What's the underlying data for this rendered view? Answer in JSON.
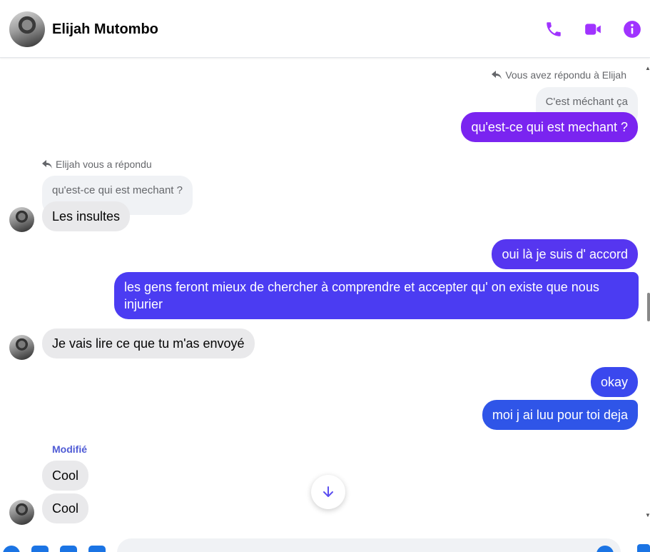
{
  "header": {
    "contact_name": "Elijah Mutombo",
    "icons": [
      "phone-icon",
      "video-camera-icon",
      "info-icon"
    ],
    "accent_color": "#a033ff"
  },
  "messages": [
    {
      "type": "reply_note",
      "text": "Vous avez répondu à Elijah"
    },
    {
      "type": "quote",
      "text": "C'est méchant ça"
    },
    {
      "type": "outgoing",
      "text": "qu'est-ce qui est mechant ?",
      "color": "#7a24f0"
    },
    {
      "type": "reply_note",
      "text": "Elijah vous a répondu"
    },
    {
      "type": "quote",
      "text": "qu'est-ce qui est mechant ?"
    },
    {
      "type": "incoming",
      "text": "Les insultes"
    },
    {
      "type": "outgoing",
      "text": "oui là je suis d' accord",
      "color": "#5636f0"
    },
    {
      "type": "outgoing",
      "text": "les gens feront mieux de chercher à comprendre et accepter qu' on existe que nous injurier",
      "color": "#4b3cf2"
    },
    {
      "type": "incoming",
      "text": "Je vais lire ce que tu m'as envoyé"
    },
    {
      "type": "outgoing",
      "text": "okay",
      "color": "#3a48ee"
    },
    {
      "type": "outgoing",
      "text": "moi j ai luu pour toi deja",
      "color": "#2f55e8"
    },
    {
      "type": "edited_label",
      "text": "Modifié"
    },
    {
      "type": "incoming",
      "text": "Cool"
    },
    {
      "type": "incoming",
      "text": "Cool"
    }
  ],
  "controls": {
    "scroll_down_icon": "arrow-down-icon",
    "composer_icons": [
      "plus-icon",
      "image-icon",
      "sticker-icon",
      "gif-icon",
      "emoji-icon",
      "like-icon"
    ]
  }
}
